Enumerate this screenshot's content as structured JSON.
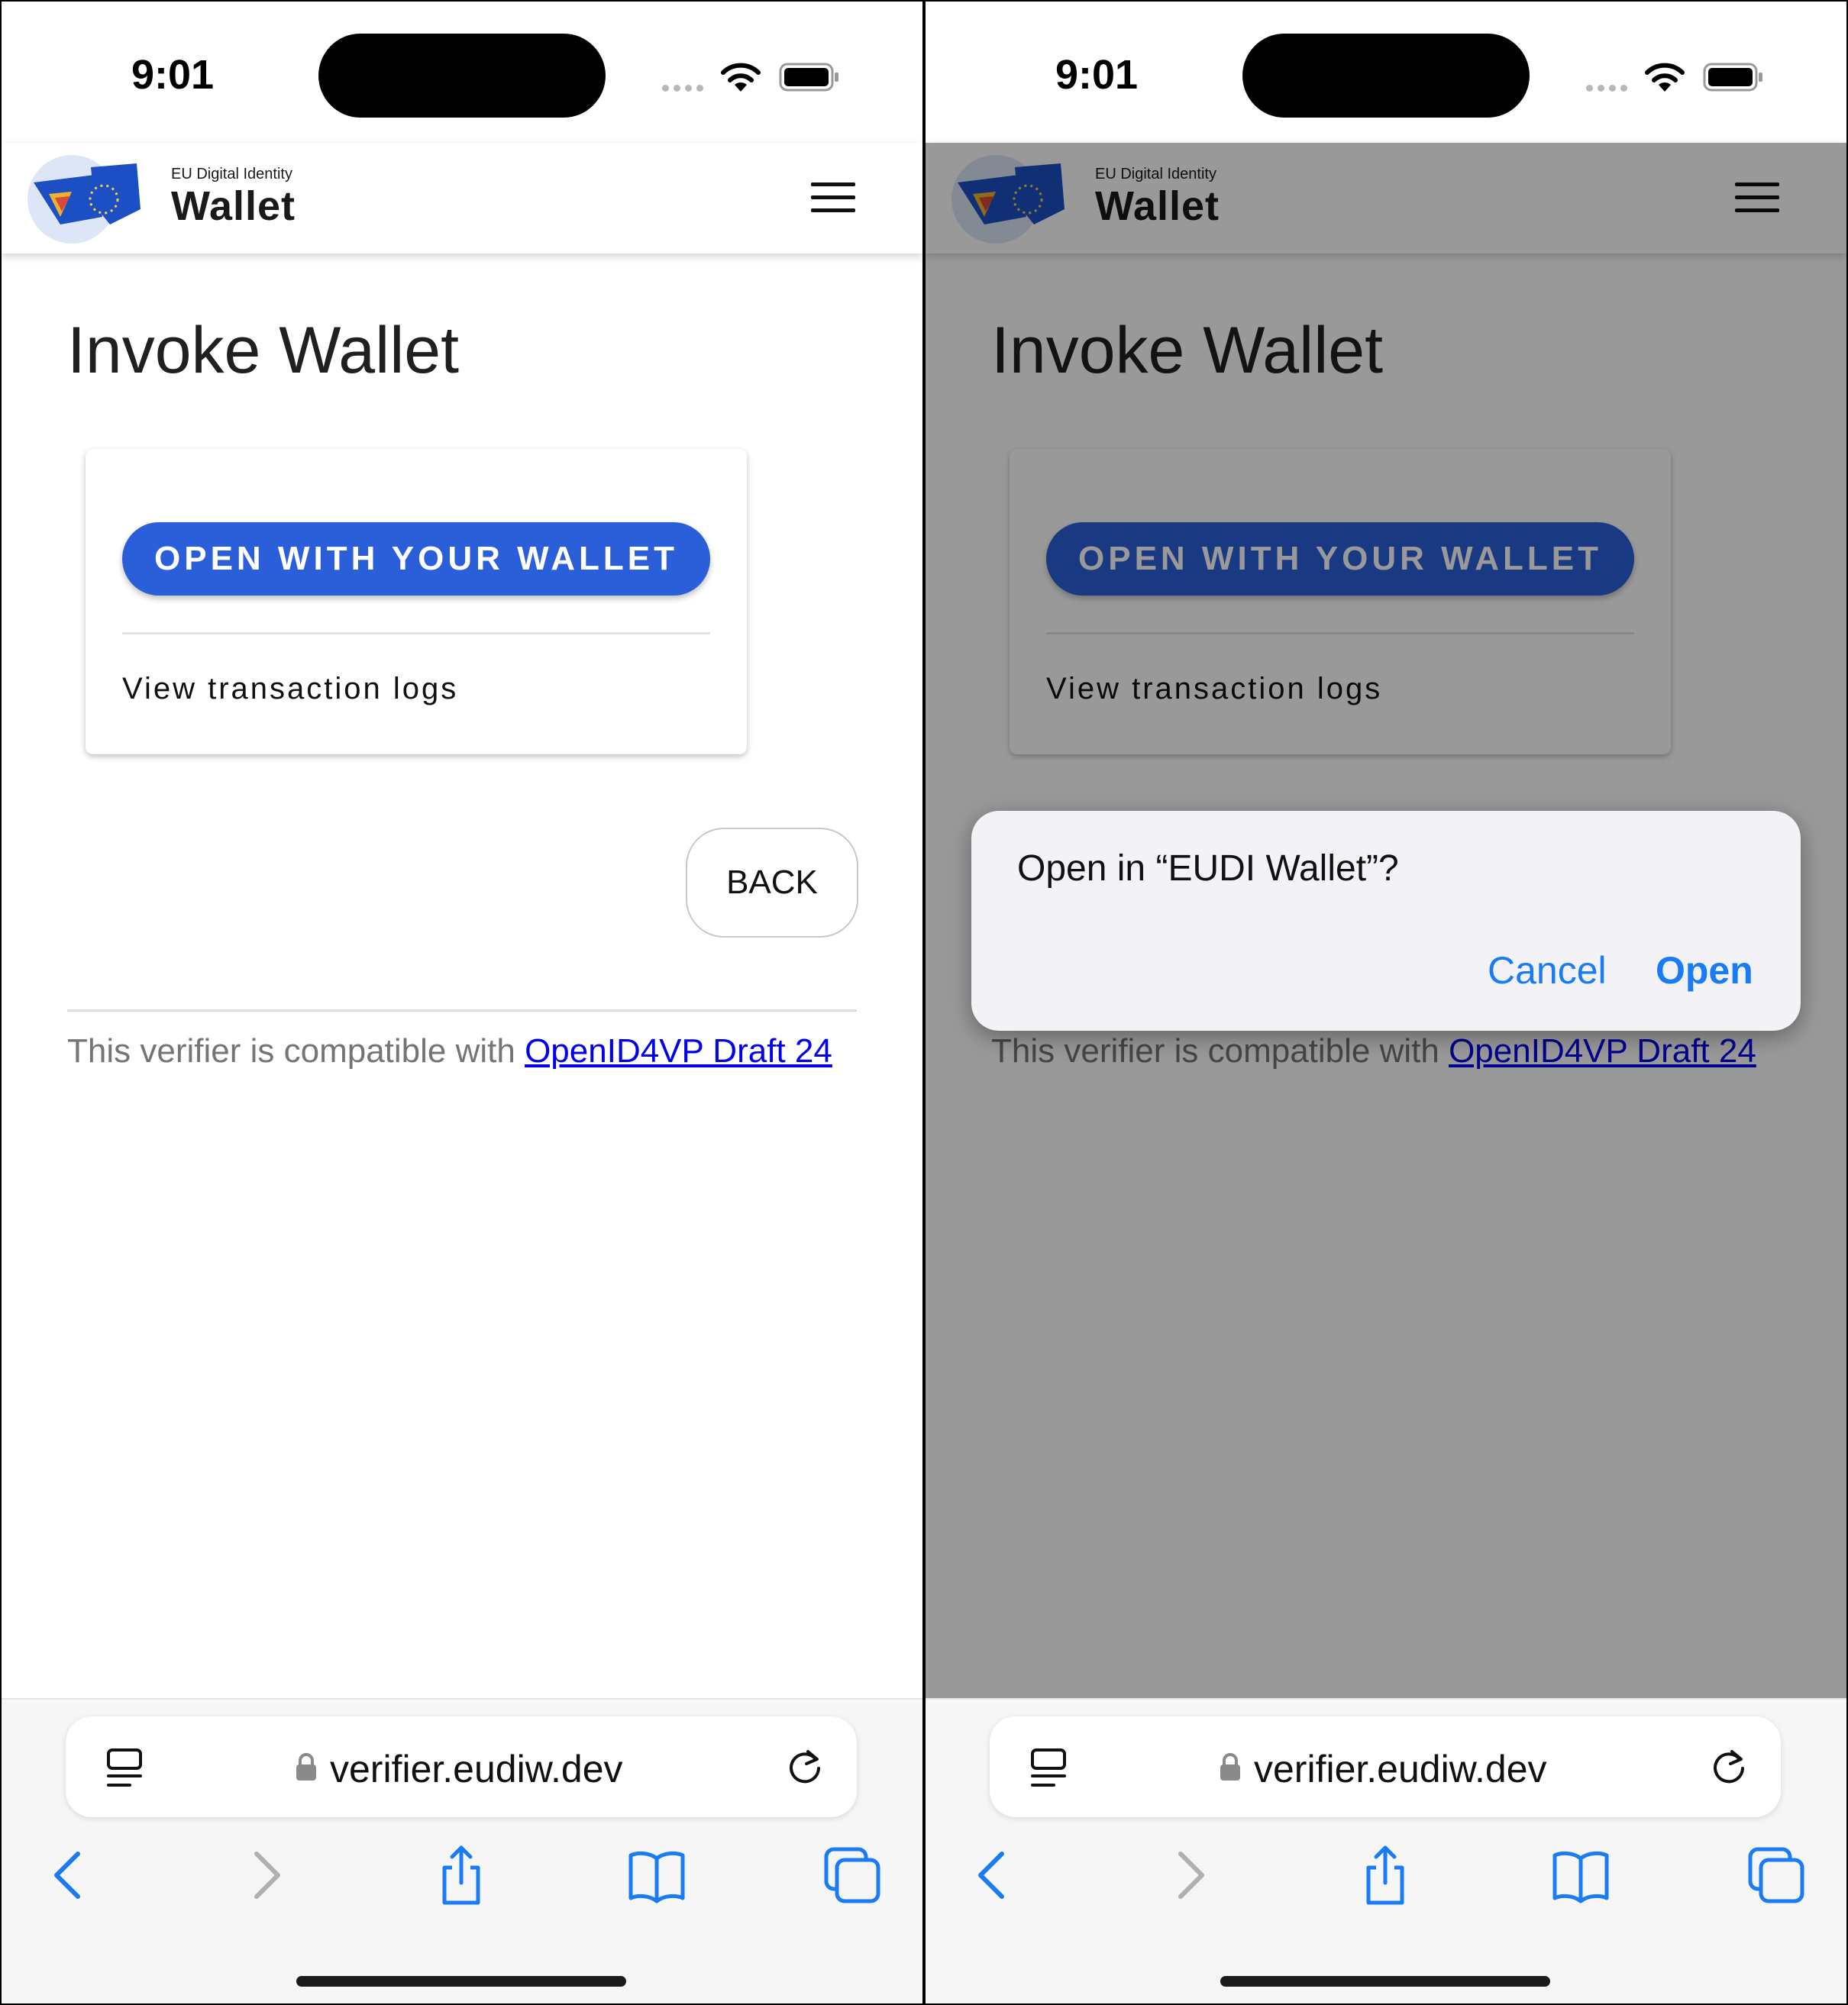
{
  "status_bar": {
    "time": "9:01"
  },
  "header": {
    "logo_top": "EU Digital Identity",
    "logo_main": "Wallet"
  },
  "page": {
    "title": "Invoke Wallet",
    "open_wallet_label": "OPEN WITH YOUR WALLET",
    "view_logs_label": "View transaction logs",
    "back_label": "BACK",
    "footer_text": "This verifier is compatible with ",
    "footer_link": "OpenID4VP Draft 24"
  },
  "browser": {
    "url": "verifier.eudiw.dev"
  },
  "dialog": {
    "title": "Open in “EUDI Wallet”?",
    "cancel_label": "Cancel",
    "open_label": "Open"
  },
  "colors": {
    "primary_button": "#2b5fd9",
    "ios_blue": "#1a7cf5",
    "link": "#0000ee"
  }
}
